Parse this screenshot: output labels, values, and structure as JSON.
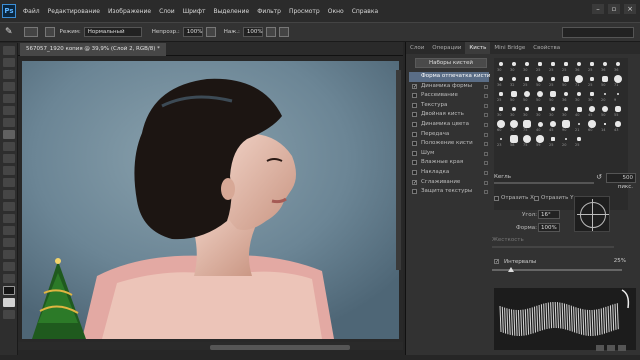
{
  "menu": {
    "logo": "Ps",
    "items": [
      "Файл",
      "Редактирование",
      "Изображение",
      "Слои",
      "Шрифт",
      "Выделение",
      "Фильтр",
      "Просмотр",
      "Окно",
      "Справка"
    ]
  },
  "options": {
    "mode_label": "Режим:",
    "mode_value": "Нормальный",
    "opacity_label": "Непрозр.:",
    "opacity_value": "100%",
    "flow_label": "Наж.:",
    "flow_value": "100%"
  },
  "document": {
    "tab_title": "567057_1920 копия @ 39,9% (Слой 2, RGB/8) *"
  },
  "panel": {
    "tabs": [
      "Слои",
      "Операции",
      "Кисть",
      "Mini Bridge",
      "Свойства"
    ],
    "active_tab": "Кисть",
    "presets_button": "Наборы кистей",
    "options": [
      {
        "label": "Форма отпечатка кисти",
        "checked": null,
        "selected": true
      },
      {
        "label": "Динамика формы",
        "checked": true
      },
      {
        "label": "Рассеивание",
        "checked": false
      },
      {
        "label": "Текстура",
        "checked": false
      },
      {
        "label": "Двойная кисть",
        "checked": false
      },
      {
        "label": "Динамика цвета",
        "checked": false
      },
      {
        "label": "Передача",
        "checked": false
      },
      {
        "label": "Положение кисти",
        "checked": false
      },
      {
        "label": "Шум",
        "checked": false
      },
      {
        "label": "Влажные края",
        "checked": false
      },
      {
        "label": "Накладка",
        "checked": false
      },
      {
        "label": "Сглаживание",
        "checked": true
      },
      {
        "label": "Защита текстуры",
        "checked": false
      }
    ],
    "tip_sizes": [
      "30",
      "30",
      "30",
      "25",
      "25",
      "25",
      "36",
      "25",
      "36",
      "36",
      "36",
      "32",
      "25",
      "50",
      "25",
      "50",
      "71",
      "25",
      "50",
      "71",
      "25",
      "50",
      "50",
      "50",
      "50",
      "36",
      "30",
      "30",
      "20",
      "9",
      "30",
      "30",
      "30",
      "30",
      "30",
      "30",
      "40",
      "45",
      "50",
      "55",
      "60",
      "70",
      "75",
      "40",
      "45",
      "90",
      "21",
      "60",
      "14",
      "43",
      "23",
      "58",
      "75",
      "59",
      "25",
      "20",
      "25"
    ],
    "size_label": "Кегль",
    "size_value": "500 пикс.",
    "flip_x": "Отразить X",
    "flip_y": "Отразить Y",
    "angle_label": "Угол:",
    "angle_value": "16°",
    "roundness_label": "Форма:",
    "roundness_value": "100%",
    "hardness_label": "Жесткость",
    "spacing_label": "Интервалы",
    "spacing_value": "25%",
    "spacing_checked": true
  },
  "icons": {
    "brush_tool": "brush-icon",
    "search": "search-icon"
  }
}
